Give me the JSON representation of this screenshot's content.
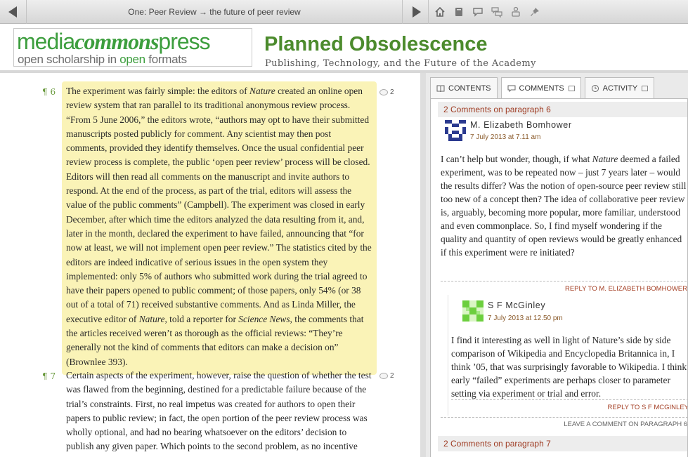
{
  "nav": {
    "breadcrumb": "One: Peer Review → the future of peer review",
    "prev_icon": "arrow-left-icon",
    "next_icon": "arrow-right-icon",
    "tools": [
      "home-icon",
      "book-icon",
      "comment-icon",
      "comments-icon",
      "print-icon",
      "pin-icon"
    ]
  },
  "header": {
    "logo_line1_a": "media",
    "logo_line1_b": "commons",
    "logo_line1_c": "press",
    "logo_line2_a": "open scholarship in ",
    "logo_line2_b": "open",
    "logo_line2_c": " formats",
    "title": "Planned Obsolescence",
    "tagline": "Publishing, Technology, and the Future of the Academy",
    "accent_color": "#4c8b2d"
  },
  "main": {
    "p6": {
      "number": "¶ 6",
      "comment_count": "2",
      "t1": "The experiment was fairly simple: the editors of ",
      "i1": "Nature",
      "t2": " created an online open review system that ran parallel to its traditional anonymous review process. “From 5 June 2006,” the editors wrote, “authors may opt to have their submitted manuscripts posted publicly for comment. Any scientist may then post comments, provided they identify themselves. Once the usual confidential peer review process is complete, the public ‘open peer review’ process will be closed. Editors will then read all comments on the manuscript and invite authors to respond. At the end of the process, as part of the trial, editors will assess the value of the public comments” (Campbell). The experiment was closed in early December, after which time the editors analyzed the data resulting from it, and, later in the month, declared the experiment to have failed, announcing that “for now at least, we will not implement open peer review.” The statistics cited by the editors are indeed indicative of serious issues in the open system they implemented: only 5% of authors who submitted work during the trial agreed to have their papers opened to public comment; of those papers, only 54% (or 38 out of a total of 71) received substantive comments. And as Linda Miller, the executive editor of ",
      "i2": "Nature",
      "t3": ", told a reporter for ",
      "i3": "Science News",
      "t4": ", the comments that the articles received weren’t as thorough as the official reviews: “They’re generally not the kind of comments that editors can make a decision on” (Brownlee 393)."
    },
    "p7": {
      "number": "¶ 7",
      "comment_count": "2",
      "text": "Certain aspects of the experiment, however, raise the question of whether the test was flawed from the beginning, destined for a predictable failure because of the trial’s constraints. First, no real impetus was created for authors to open their papers to public review; in fact, the open portion of the peer review process was wholly optional, and had no bearing whatsoever on the editors’ decision to publish any given paper. Which points to the second problem, as no incentive was created for commenters"
    }
  },
  "sidebar": {
    "tabs": [
      {
        "label": "Contents",
        "icon": "book-icon"
      },
      {
        "label": "Comments",
        "icon": "comment-icon"
      },
      {
        "label": "Activity",
        "icon": "clock-icon"
      }
    ],
    "section_p6": "2 Comments on paragraph 6",
    "comment1": {
      "author": "M. Elizabeth Bomhower",
      "date": "7 July 2013 at 7.11 am",
      "t1": "I can’t help but wonder, though, if what ",
      "i1": "Nature",
      "t2": " deemed a failed experiment, was to be repeated now – just 7 years later – would the results differ? Was the notion of open-source peer review still too new of a concept then? The idea of collaborative peer review is, arguably, becoming more popular, more familiar, understood and even commonplace. So, I find myself wondering if the quality and quantity of open reviews would be greatly enhanced if this experiment were re initiated?",
      "reply": "Reply to M. Elizabeth Bomhower"
    },
    "comment2": {
      "author": "S F McGinley",
      "date": "7 July 2013 at 12.50 pm",
      "text": "I find it interesting as well in light of Nature’s side by side comparison of Wikipedia and Encyclopedia Britannica in, I think ’05, that was surprisingly favorable to Wikipedia. I think early “failed” experiments are perhaps closer to parameter setting via experiment or trial and error.",
      "reply": "Reply to S F McGinley"
    },
    "leave_comment": "Leave a comment on paragraph 6",
    "section_p7": "2 Comments on paragraph 7"
  }
}
